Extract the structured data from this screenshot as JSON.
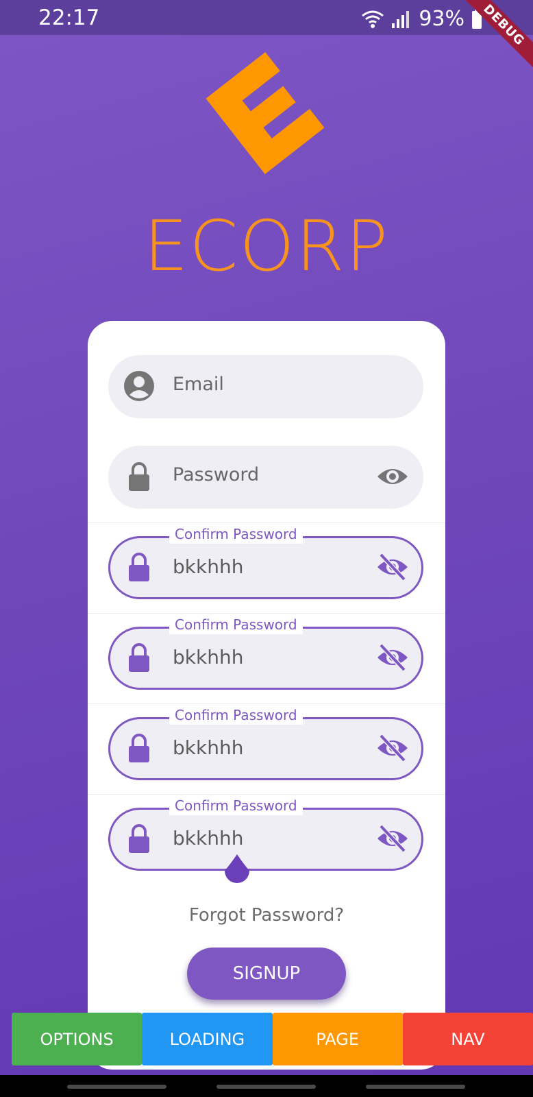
{
  "status": {
    "time": "22:17",
    "battery": "93%"
  },
  "debug_banner": "DEBUG",
  "brand": {
    "name": "ECORP",
    "accent": "#f7931e"
  },
  "form": {
    "email": {
      "placeholder": "Email",
      "icon": "account-circle-icon"
    },
    "password": {
      "placeholder": "Password",
      "icon": "lock-icon",
      "toggle_icon": "eye-icon"
    },
    "confirm_fields": [
      {
        "label": "Confirm Password",
        "value": "bkkhhh",
        "icon": "lock-icon",
        "toggle_icon": "eye-off-icon"
      },
      {
        "label": "Confirm Password",
        "value": "bkkhhh",
        "icon": "lock-icon",
        "toggle_icon": "eye-off-icon"
      },
      {
        "label": "Confirm Password",
        "value": "bkkhhh",
        "icon": "lock-icon",
        "toggle_icon": "eye-off-icon"
      },
      {
        "label": "Confirm Password",
        "value": "bkkhhh",
        "icon": "lock-icon",
        "toggle_icon": "eye-off-icon"
      }
    ],
    "forgot_password": "Forgot Password?",
    "signup_label": "SIGNUP",
    "primary_color": "#7e57c2"
  },
  "bottom_buttons": [
    {
      "label": "OPTIONS",
      "color": "#4caf50"
    },
    {
      "label": "LOADING",
      "color": "#2196f3"
    },
    {
      "label": "PAGE",
      "color": "#ff9800"
    },
    {
      "label": "NAV",
      "color": "#f44336"
    }
  ]
}
